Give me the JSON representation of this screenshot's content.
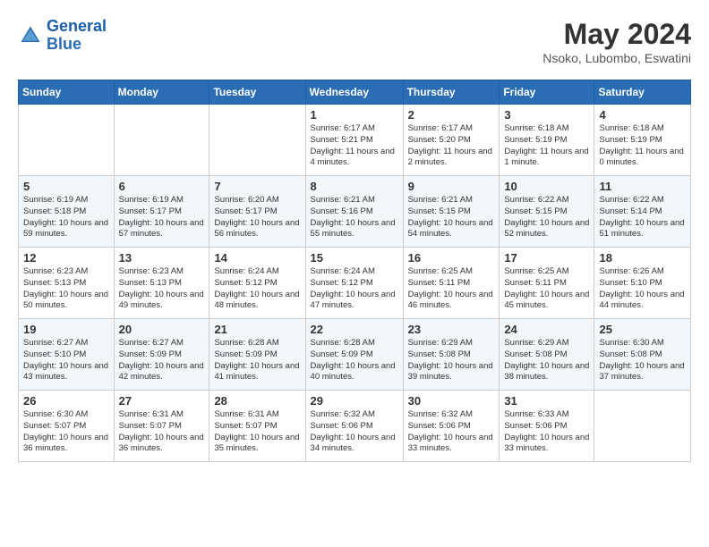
{
  "header": {
    "logo_line1": "General",
    "logo_line2": "Blue",
    "month_title": "May 2024",
    "subtitle": "Nsoko, Lubombo, Eswatini"
  },
  "weekdays": [
    "Sunday",
    "Monday",
    "Tuesday",
    "Wednesday",
    "Thursday",
    "Friday",
    "Saturday"
  ],
  "weeks": [
    [
      null,
      null,
      null,
      {
        "day": 1,
        "sunrise": "6:17 AM",
        "sunset": "5:21 PM",
        "daylight": "11 hours and 4 minutes."
      },
      {
        "day": 2,
        "sunrise": "6:17 AM",
        "sunset": "5:20 PM",
        "daylight": "11 hours and 2 minutes."
      },
      {
        "day": 3,
        "sunrise": "6:18 AM",
        "sunset": "5:19 PM",
        "daylight": "11 hours and 1 minute."
      },
      {
        "day": 4,
        "sunrise": "6:18 AM",
        "sunset": "5:19 PM",
        "daylight": "11 hours and 0 minutes."
      }
    ],
    [
      {
        "day": 5,
        "sunrise": "6:19 AM",
        "sunset": "5:18 PM",
        "daylight": "10 hours and 59 minutes."
      },
      {
        "day": 6,
        "sunrise": "6:19 AM",
        "sunset": "5:17 PM",
        "daylight": "10 hours and 57 minutes."
      },
      {
        "day": 7,
        "sunrise": "6:20 AM",
        "sunset": "5:17 PM",
        "daylight": "10 hours and 56 minutes."
      },
      {
        "day": 8,
        "sunrise": "6:21 AM",
        "sunset": "5:16 PM",
        "daylight": "10 hours and 55 minutes."
      },
      {
        "day": 9,
        "sunrise": "6:21 AM",
        "sunset": "5:15 PM",
        "daylight": "10 hours and 54 minutes."
      },
      {
        "day": 10,
        "sunrise": "6:22 AM",
        "sunset": "5:15 PM",
        "daylight": "10 hours and 52 minutes."
      },
      {
        "day": 11,
        "sunrise": "6:22 AM",
        "sunset": "5:14 PM",
        "daylight": "10 hours and 51 minutes."
      }
    ],
    [
      {
        "day": 12,
        "sunrise": "6:23 AM",
        "sunset": "5:13 PM",
        "daylight": "10 hours and 50 minutes."
      },
      {
        "day": 13,
        "sunrise": "6:23 AM",
        "sunset": "5:13 PM",
        "daylight": "10 hours and 49 minutes."
      },
      {
        "day": 14,
        "sunrise": "6:24 AM",
        "sunset": "5:12 PM",
        "daylight": "10 hours and 48 minutes."
      },
      {
        "day": 15,
        "sunrise": "6:24 AM",
        "sunset": "5:12 PM",
        "daylight": "10 hours and 47 minutes."
      },
      {
        "day": 16,
        "sunrise": "6:25 AM",
        "sunset": "5:11 PM",
        "daylight": "10 hours and 46 minutes."
      },
      {
        "day": 17,
        "sunrise": "6:25 AM",
        "sunset": "5:11 PM",
        "daylight": "10 hours and 45 minutes."
      },
      {
        "day": 18,
        "sunrise": "6:26 AM",
        "sunset": "5:10 PM",
        "daylight": "10 hours and 44 minutes."
      }
    ],
    [
      {
        "day": 19,
        "sunrise": "6:27 AM",
        "sunset": "5:10 PM",
        "daylight": "10 hours and 43 minutes."
      },
      {
        "day": 20,
        "sunrise": "6:27 AM",
        "sunset": "5:09 PM",
        "daylight": "10 hours and 42 minutes."
      },
      {
        "day": 21,
        "sunrise": "6:28 AM",
        "sunset": "5:09 PM",
        "daylight": "10 hours and 41 minutes."
      },
      {
        "day": 22,
        "sunrise": "6:28 AM",
        "sunset": "5:09 PM",
        "daylight": "10 hours and 40 minutes."
      },
      {
        "day": 23,
        "sunrise": "6:29 AM",
        "sunset": "5:08 PM",
        "daylight": "10 hours and 39 minutes."
      },
      {
        "day": 24,
        "sunrise": "6:29 AM",
        "sunset": "5:08 PM",
        "daylight": "10 hours and 38 minutes."
      },
      {
        "day": 25,
        "sunrise": "6:30 AM",
        "sunset": "5:08 PM",
        "daylight": "10 hours and 37 minutes."
      }
    ],
    [
      {
        "day": 26,
        "sunrise": "6:30 AM",
        "sunset": "5:07 PM",
        "daylight": "10 hours and 36 minutes."
      },
      {
        "day": 27,
        "sunrise": "6:31 AM",
        "sunset": "5:07 PM",
        "daylight": "10 hours and 36 minutes."
      },
      {
        "day": 28,
        "sunrise": "6:31 AM",
        "sunset": "5:07 PM",
        "daylight": "10 hours and 35 minutes."
      },
      {
        "day": 29,
        "sunrise": "6:32 AM",
        "sunset": "5:06 PM",
        "daylight": "10 hours and 34 minutes."
      },
      {
        "day": 30,
        "sunrise": "6:32 AM",
        "sunset": "5:06 PM",
        "daylight": "10 hours and 33 minutes."
      },
      {
        "day": 31,
        "sunrise": "6:33 AM",
        "sunset": "5:06 PM",
        "daylight": "10 hours and 33 minutes."
      },
      null
    ]
  ]
}
